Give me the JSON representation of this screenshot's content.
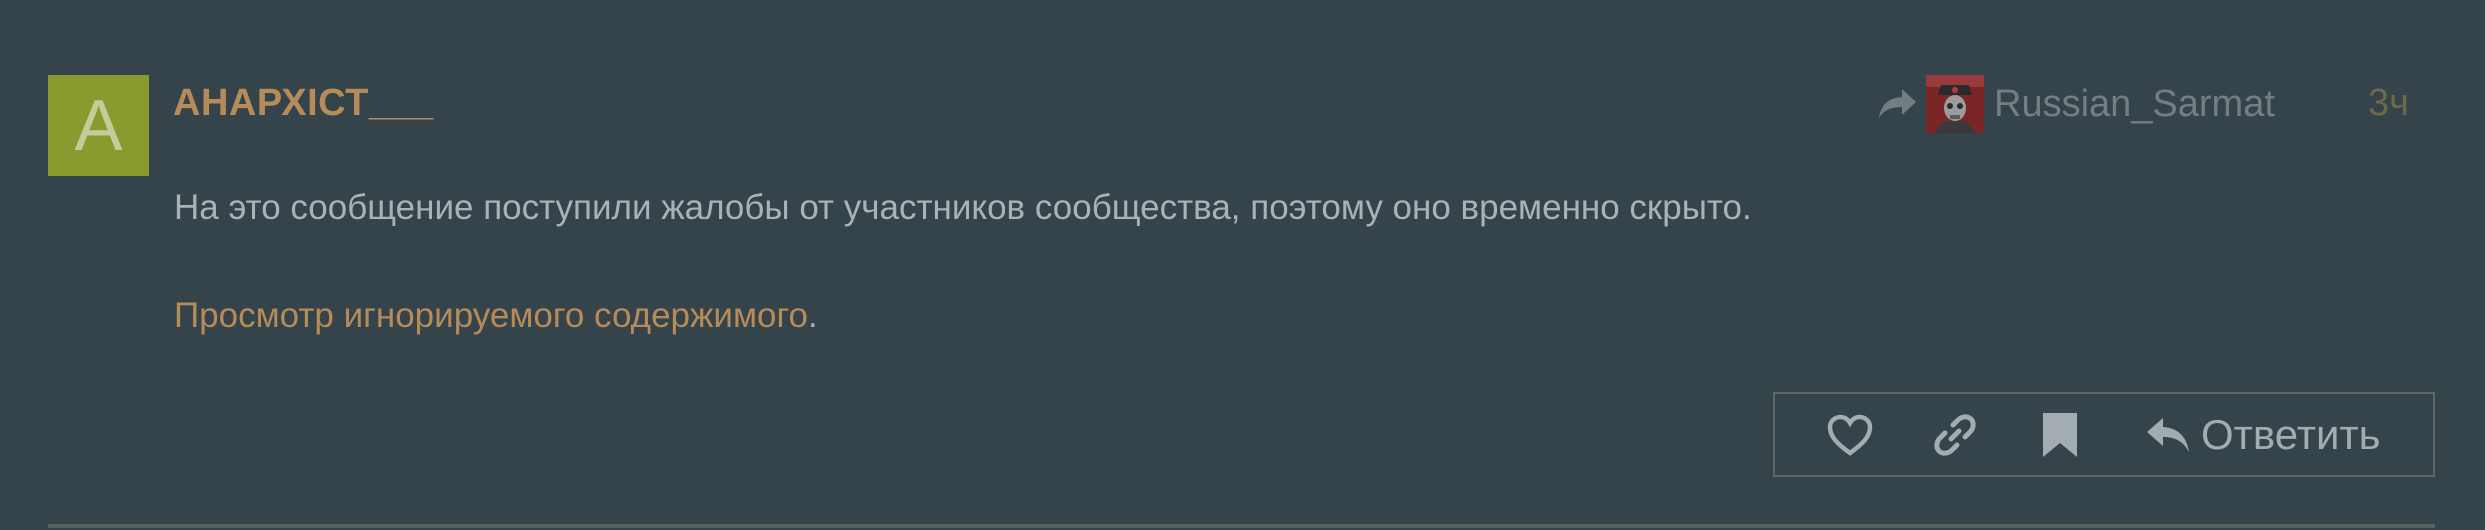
{
  "post": {
    "avatar_letter": "A",
    "avatar_color": "#8a9a2e",
    "username": "АНАРХІСТ___",
    "reply_to": {
      "icon": "share-arrow-icon",
      "name": "Russian_Sarmat"
    },
    "date": "3ч",
    "hidden_notice": "На это сообщение поступили жалобы от участников сообщества, поэтому оно временно скрыто.",
    "view_ignored_link": "Просмотр игнорируемого содержимого",
    "view_ignored_suffix": "."
  },
  "actions": {
    "like_icon": "heart-icon",
    "link_icon": "link-icon",
    "bookmark_icon": "bookmark-icon",
    "reply_icon": "reply-icon",
    "reply_label": "Ответить"
  },
  "colors": {
    "background": "#35434a",
    "username": "#b68b5a",
    "link": "#b68b5a",
    "text": "#a9b2b6"
  }
}
